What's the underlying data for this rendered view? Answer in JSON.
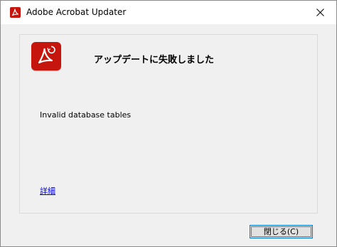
{
  "window": {
    "title": "Adobe Acrobat Updater"
  },
  "dialog": {
    "heading": "アップデートに失敗しました",
    "message": "Invalid database tables",
    "details_link": "詳細",
    "close_button": "閉じる(C)"
  },
  "icons": {
    "title": "acrobat-icon",
    "close": "close-icon",
    "app": "acrobat-update-icon"
  },
  "colors": {
    "acrobat_red": "#c5150c",
    "link": "#0000ee",
    "focus_border": "#0078d7"
  }
}
